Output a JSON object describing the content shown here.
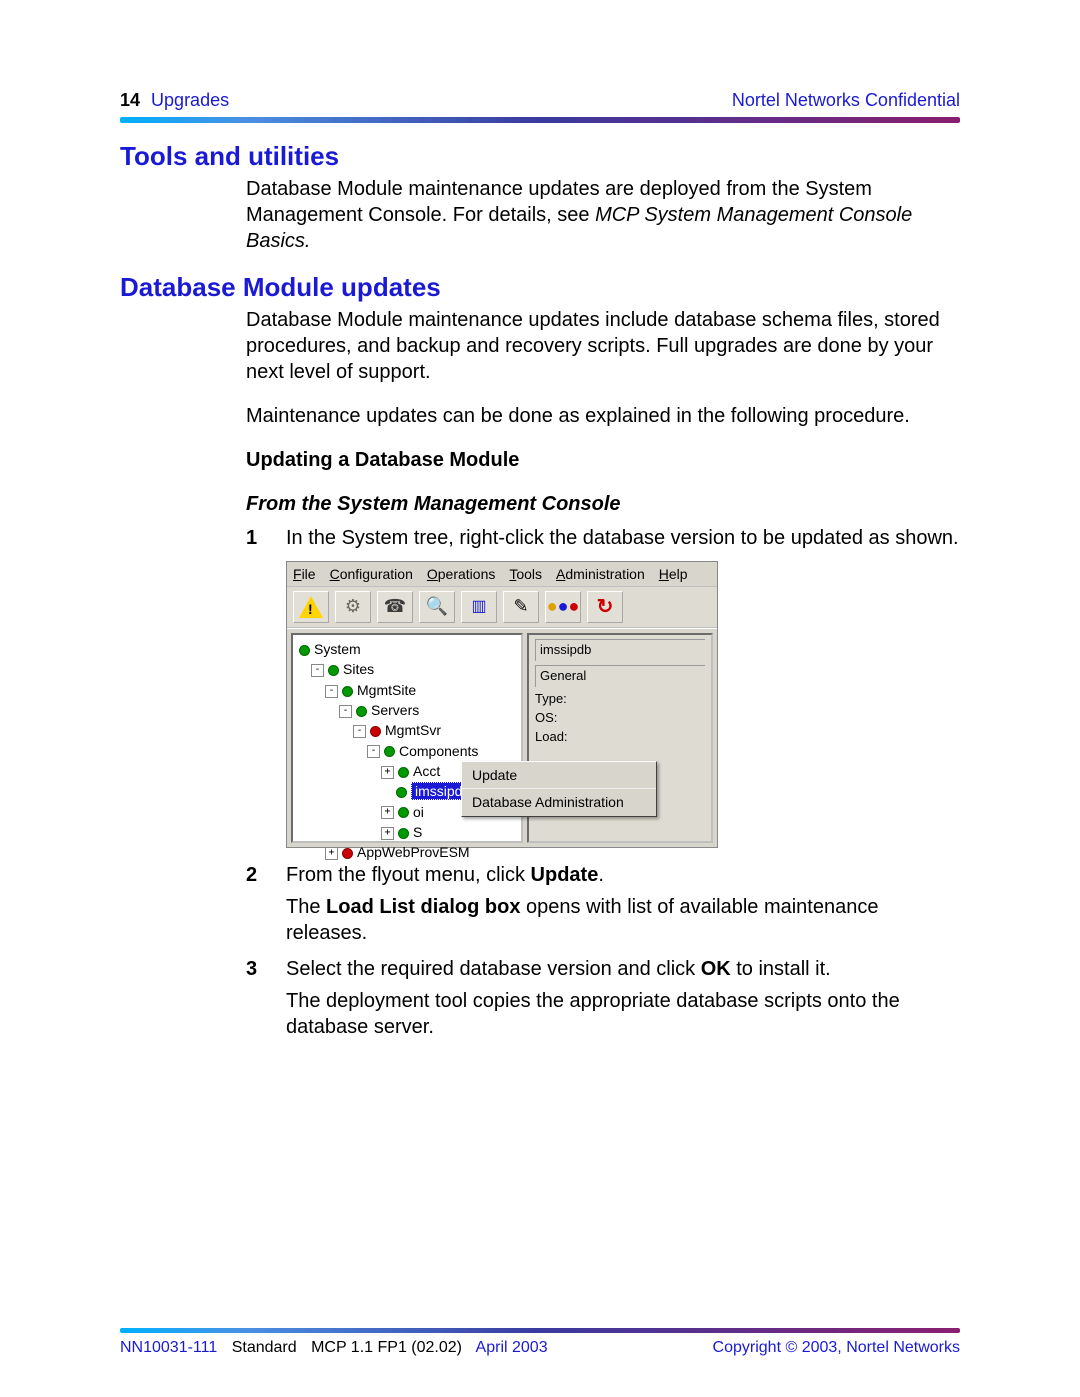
{
  "header": {
    "page_number": "14",
    "section": "Upgrades",
    "confidential": "Nortel Networks Confidential"
  },
  "sections": {
    "tools": {
      "title": "Tools and utilities",
      "para_a": "Database Module maintenance updates are deployed from the System Management Console. For details, see ",
      "para_ref": "MCP System Management Console Basics.",
      "para_b": ""
    },
    "dbupd": {
      "title": "Database Module updates",
      "para1": "Database Module maintenance updates include database schema files, stored procedures, and backup and recovery scripts. Full upgrades are done by your next level of support.",
      "para2": "Maintenance updates can be done as explained in the following procedure.",
      "sub1": "Updating a Database Module",
      "sub2": "From the System Management Console",
      "step1_num": "1",
      "step1_txt": "In the System tree, right-click the database version to be updated as shown.",
      "step2_num": "2",
      "step2_txt_a": "From the flyout menu, click ",
      "step2_txt_b": "Update",
      "step2_txt_c": ".",
      "step2_result_a": "The ",
      "step2_result_b": "Load List dialog box",
      "step2_result_c": " opens with list of available maintenance releases.",
      "step3_num": "3",
      "step3_txt_a": "Select the required database version and click ",
      "step3_txt_b": "OK",
      "step3_txt_c": " to install it.",
      "step3_result": "The deployment tool copies the appropriate database scripts onto the database server."
    }
  },
  "screenshot": {
    "menubar": [
      "File",
      "Configuration",
      "Operations",
      "Tools",
      "Administration",
      "Help"
    ],
    "tree": {
      "root": "System",
      "sites": "Sites",
      "mgmtsite": "MgmtSite",
      "servers": "Servers",
      "mgmtsvr": "MgmtSvr",
      "components": "Components",
      "acct": "Acct",
      "selected": "imssipdb",
      "oi": "oi",
      "s": "S",
      "appweb": "AppWebProvESM"
    },
    "context_menu": [
      "Update",
      "Database Administration"
    ],
    "right": {
      "title_trunc": "imssipdb",
      "group": "General",
      "type": "Type:",
      "os": "OS:",
      "load": "Load:"
    }
  },
  "footer": {
    "doc_id": "NN10031-111",
    "class": "Standard",
    "rel": "MCP 1.1 FP1 (02.02)",
    "date": "April 2003",
    "copyright": "Copyright © 2003, Nortel Networks"
  }
}
